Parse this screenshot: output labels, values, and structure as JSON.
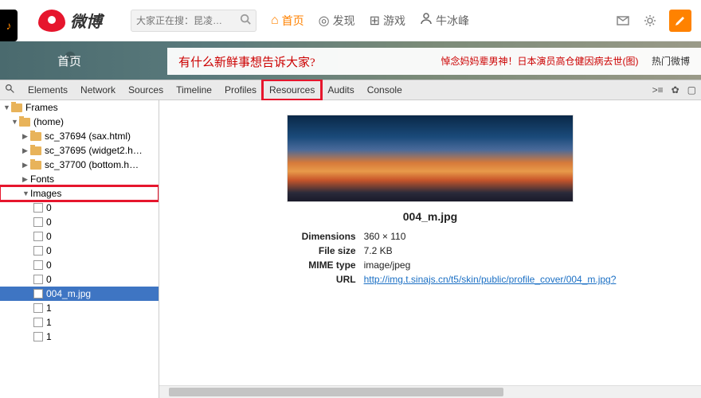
{
  "header": {
    "logo_text": "微博",
    "search_placeholder": "大家正在搜：昆凌…",
    "nav": [
      {
        "label": "首页",
        "active": true
      },
      {
        "label": "发现"
      },
      {
        "label": "游戏"
      },
      {
        "label": "牛冰峰"
      }
    ]
  },
  "banner": {
    "home": "首页",
    "question": "有什么新鲜事想告诉大家?",
    "news": "悼念妈妈辈男神！日本演员高仓健因病去世(图)",
    "hot": "热门微博"
  },
  "devtools": {
    "tabs": [
      "Elements",
      "Network",
      "Sources",
      "Timeline",
      "Profiles",
      "Resources",
      "Audits",
      "Console"
    ],
    "highlighted_tab": "Resources"
  },
  "tree": {
    "root": "Frames",
    "home": "(home)",
    "files": [
      "sc_37694 (sax.html)",
      "sc_37695 (widget2.h…",
      "sc_37700 (bottom.h…"
    ],
    "fonts": "Fonts",
    "images_label": "Images",
    "images": [
      "0",
      "0",
      "0",
      "0",
      "0",
      "0",
      "004_m.jpg",
      "1",
      "1",
      "1"
    ],
    "selected": "004_m.jpg"
  },
  "preview": {
    "filename": "004_m.jpg",
    "meta": [
      {
        "label": "Dimensions",
        "value": "360 × 110"
      },
      {
        "label": "File size",
        "value": "7.2 KB"
      },
      {
        "label": "MIME type",
        "value": "image/jpeg"
      },
      {
        "label": "URL",
        "value": "http://img.t.sinajs.cn/t5/skin/public/profile_cover/004_m.jpg?",
        "link": true
      }
    ]
  }
}
